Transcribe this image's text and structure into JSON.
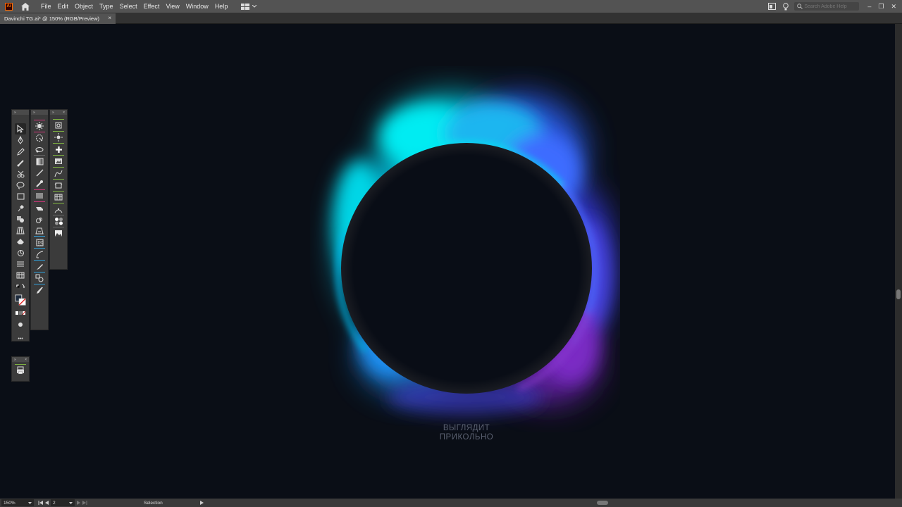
{
  "app": {
    "logo": "Ai",
    "menu": [
      "File",
      "Edit",
      "Object",
      "Type",
      "Select",
      "Effect",
      "View",
      "Window",
      "Help"
    ],
    "search_placeholder": "Search Adobe Help",
    "window_controls": [
      "–",
      "❐",
      "✕"
    ]
  },
  "document": {
    "tab_title": "Davinchi TG.ai* @ 150% (RGB/Preview)",
    "tab_close": "×"
  },
  "artwork": {
    "caption_line1": "ВЫГЛЯДИТ",
    "caption_line2": "ПРИКОЛЬНО",
    "glow_colors": {
      "cyan": "#00e5f0",
      "blue": "#3a6cff",
      "purple": "#7a2fc0",
      "background": "#0a0e16",
      "disk": "#090d16"
    }
  },
  "toolbar": {
    "panel_head": "»",
    "close": "×",
    "more": "•••",
    "col1": [
      "selection-tool",
      "pen-tool",
      "pencil-tool",
      "brush-tool",
      "scissors-tool",
      "lasso-tool",
      "rectangle-tool",
      "pin-tool",
      "shape-builder-tool",
      "perspective-tool",
      "eraser-tool",
      "rotate-tool",
      "blend-tool",
      "chart-tool"
    ],
    "col2": [
      "symbol-sprayer-tool",
      "lasso-select-tool",
      "rotate-3d-tool",
      "gradient-tool",
      "line-tool",
      "paintbrush-tool",
      "paragraph-tool",
      "smooth-tool",
      "spiral-tool",
      "live-paint-tool",
      "mesh-tool",
      "curvature-tool",
      "knife-tool",
      "shape-mode-tool",
      "blob-brush-tool"
    ],
    "col3": [
      "artboard-tool",
      "sun-tool",
      "plus-tool",
      "image-tool",
      "wave-tool",
      "crop-tool",
      "grid-tool",
      "anchor-tool",
      "spheres-tool",
      "landscape-tool"
    ]
  },
  "status": {
    "zoom": "150%",
    "artboard": "2",
    "current_tool": "Selection"
  }
}
